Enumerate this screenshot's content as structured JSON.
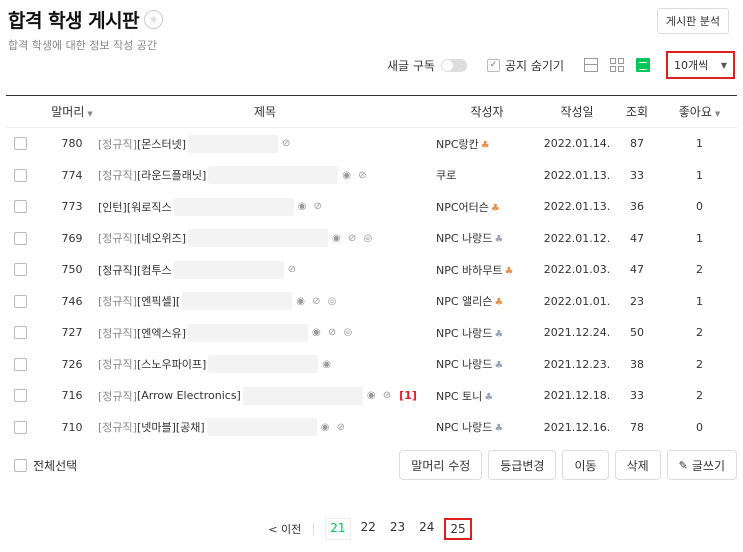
{
  "board": {
    "title": "합격 학생 게시판",
    "description": "합격 학생에 대한 정보 작성 공간",
    "analyze_label": "게시판 분석"
  },
  "toolbar": {
    "subscribe_label": "새글 구독",
    "hide_notice_label": "공지 숨기기",
    "per_page": "10개씩"
  },
  "table": {
    "headers": {
      "category": "말머리",
      "title": "제목",
      "author": "작성자",
      "date": "작성일",
      "views": "조회",
      "likes": "좋아요"
    },
    "rows": [
      {
        "num": "780",
        "category": "[정규직]",
        "title": "[몬스터넷]",
        "icons": "⊘",
        "author": "NPC랑칸",
        "badge": "gold",
        "badge_icon": "♣",
        "date": "2022.01.14.",
        "views": "87",
        "likes": "1",
        "comment": ""
      },
      {
        "num": "774",
        "category": "[정규직]",
        "title": "[라운드플래닛]",
        "icons": "◉ ⊘",
        "author": "쿠로",
        "badge": "",
        "badge_icon": "",
        "date": "2022.01.13.",
        "views": "33",
        "likes": "1",
        "comment": ""
      },
      {
        "num": "773",
        "category": "",
        "title": "[인턴][워로직스",
        "icons": "◉ ⊘",
        "author": "NPC어터슨",
        "badge": "gold",
        "badge_icon": "♣",
        "date": "2022.01.13.",
        "views": "36",
        "likes": "0",
        "comment": ""
      },
      {
        "num": "769",
        "category": "[정규직]",
        "title": "[네오위즈]",
        "icons": "◉ ⊘ ◎",
        "author": "NPC 나랑드",
        "badge": "silver",
        "badge_icon": "♣",
        "date": "2022.01.12.",
        "views": "47",
        "likes": "1",
        "comment": ""
      },
      {
        "num": "750",
        "category": "",
        "title": "[정규직][컴투스",
        "icons": "⊘",
        "author": "NPC 바하무트",
        "badge": "gold",
        "badge_icon": "♣",
        "date": "2022.01.03.",
        "views": "47",
        "likes": "2",
        "comment": ""
      },
      {
        "num": "746",
        "category": "[정규직]",
        "title": "[엔픽셀][",
        "icons": "◉ ⊘ ◎",
        "author": "NPC 앨리슨",
        "badge": "gold",
        "badge_icon": "♣",
        "date": "2022.01.01.",
        "views": "23",
        "likes": "1",
        "comment": ""
      },
      {
        "num": "727",
        "category": "[정규직]",
        "title": "[엔엑스유]",
        "icons": "◉ ⊘ ◎",
        "author": "NPC 나랑드",
        "badge": "silver",
        "badge_icon": "♣",
        "date": "2021.12.24.",
        "views": "50",
        "likes": "2",
        "comment": ""
      },
      {
        "num": "726",
        "category": "[정규직]",
        "title": "[스노우파이프]",
        "icons": "◉",
        "author": "NPC 나랑드",
        "badge": "silver",
        "badge_icon": "♣",
        "date": "2021.12.23.",
        "views": "38",
        "likes": "2",
        "comment": ""
      },
      {
        "num": "716",
        "category": "[정규직]",
        "title": "[Arrow Electronics]",
        "icons": "◉ ⊘",
        "author": "NPC 토니",
        "badge": "silver",
        "badge_icon": "♣",
        "date": "2021.12.18.",
        "views": "33",
        "likes": "2",
        "comment": "[1]"
      },
      {
        "num": "710",
        "category": "[정규직]",
        "title": "[넷마블][공채]",
        "icons": "◉ ⊘",
        "author": "NPC 나랑드",
        "badge": "silver",
        "badge_icon": "♣",
        "date": "2021.12.16.",
        "views": "78",
        "likes": "0",
        "comment": ""
      }
    ]
  },
  "actions": {
    "select_all_label": "전체선택",
    "edit_category_label": "말머리 수정",
    "change_grade_label": "등급변경",
    "move_label": "이동",
    "delete_label": "삭제",
    "write_label": "글쓰기"
  },
  "pagination": {
    "prev_label": "< 이전",
    "pages": [
      "21",
      "22",
      "23",
      "24",
      "25"
    ],
    "current": "21",
    "highlighted": "25"
  },
  "colors": {
    "accent": "#03c75a",
    "highlight_box": "#e02020"
  }
}
